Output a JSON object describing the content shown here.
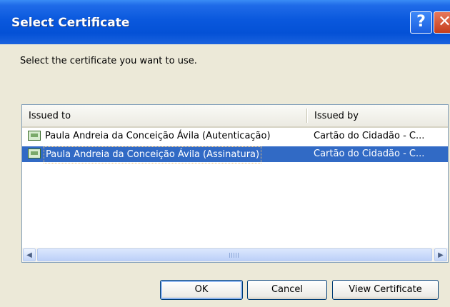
{
  "window": {
    "title": "Select Certificate",
    "help_label": "?",
    "close_label": "✕"
  },
  "prompt": "Select the certificate you want to use.",
  "list": {
    "columns": [
      "Issued to",
      "Issued by"
    ],
    "rows": [
      {
        "issued_to": "Paula Andreia da Conceição Ávila (Autenticação)",
        "issued_by": "Cartão do Cidadão - C...",
        "selected": false
      },
      {
        "issued_to": "Paula Andreia da Conceição Ávila (Assinatura)",
        "issued_by": "Cartão do Cidadão - C...",
        "selected": true
      }
    ]
  },
  "scrollbar": {
    "left_arrow": "◀",
    "right_arrow": "▶"
  },
  "buttons": {
    "ok": "OK",
    "cancel": "Cancel",
    "view_certificate": "View Certificate"
  }
}
